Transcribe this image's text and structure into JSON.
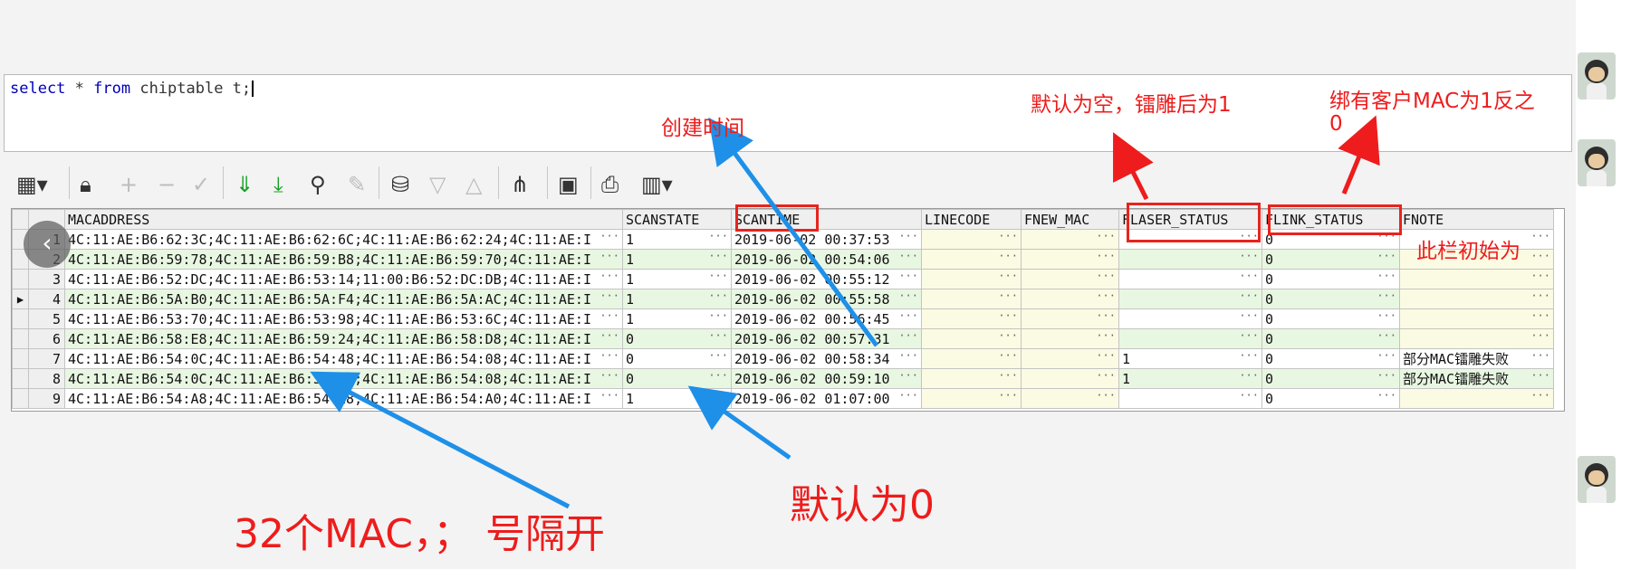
{
  "sql": {
    "keyword_select": "select",
    "star": " * ",
    "keyword_from": "from",
    "rest": " chiptable t;"
  },
  "grid": {
    "columns": [
      "MACADDRESS",
      "SCANSTATE",
      "SCANTIME",
      "LINECODE",
      "FNEW_MAC",
      "FLASER_STATUS",
      "FLINK_STATUS",
      "FNOTE"
    ],
    "rows": [
      {
        "n": "1",
        "mac": "4C:11:AE:B6:62:3C;4C:11:AE:B6:62:6C;4C:11:AE:B6:62:24;4C:11:AE:I",
        "scanstate": "1",
        "scantime": "2019-06-02 00:37:53",
        "linecode": "",
        "fnew_mac": "",
        "flaser": "",
        "flink": "0",
        "fnote": ""
      },
      {
        "n": "2",
        "mac": "4C:11:AE:B6:59:78;4C:11:AE:B6:59:B8;4C:11:AE:B6:59:70;4C:11:AE:I",
        "scanstate": "1",
        "scantime": "2019-06-02 00:54:06",
        "linecode": "",
        "fnew_mac": "",
        "flaser": "",
        "flink": "0",
        "fnote": ""
      },
      {
        "n": "3",
        "mac": "4C:11:AE:B6:52:DC;4C:11:AE:B6:53:14;11:00:B6:52:DC:DB;4C:11:AE:I",
        "scanstate": "1",
        "scantime": "2019-06-02 00:55:12",
        "linecode": "",
        "fnew_mac": "",
        "flaser": "",
        "flink": "0",
        "fnote": ""
      },
      {
        "n": "4",
        "mac": "4C:11:AE:B6:5A:B0;4C:11:AE:B6:5A:F4;4C:11:AE:B6:5A:AC;4C:11:AE:I",
        "scanstate": "1",
        "scantime": "2019-06-02 00:55:58",
        "linecode": "",
        "fnew_mac": "",
        "flaser": "",
        "flink": "0",
        "fnote": ""
      },
      {
        "n": "5",
        "mac": "4C:11:AE:B6:53:70;4C:11:AE:B6:53:98;4C:11:AE:B6:53:6C;4C:11:AE:I",
        "scanstate": "1",
        "scantime": "2019-06-02 00:56:45",
        "linecode": "",
        "fnew_mac": "",
        "flaser": "",
        "flink": "0",
        "fnote": ""
      },
      {
        "n": "6",
        "mac": "4C:11:AE:B6:58:E8;4C:11:AE:B6:59:24;4C:11:AE:B6:58:D8;4C:11:AE:I",
        "scanstate": "0",
        "scantime": "2019-06-02 00:57:31",
        "linecode": "",
        "fnew_mac": "",
        "flaser": "",
        "flink": "0",
        "fnote": ""
      },
      {
        "n": "7",
        "mac": "4C:11:AE:B6:54:0C;4C:11:AE:B6:54:48;4C:11:AE:B6:54:08;4C:11:AE:I",
        "scanstate": "0",
        "scantime": "2019-06-02 00:58:34",
        "linecode": "",
        "fnew_mac": "",
        "flaser": "1",
        "flink": "0",
        "fnote": "部分MAC镭雕失败"
      },
      {
        "n": "8",
        "mac": "4C:11:AE:B6:54:0C;4C:11:AE:B6:54:48;4C:11:AE:B6:54:08;4C:11:AE:I",
        "scanstate": "0",
        "scantime": "2019-06-02 00:59:10",
        "linecode": "",
        "fnew_mac": "",
        "flaser": "1",
        "flink": "0",
        "fnote": "部分MAC镭雕失败"
      },
      {
        "n": "9",
        "mac": "4C:11:AE:B6:54:A8;4C:11:AE:B6:54:E8;4C:11:AE:B6:54:A0;4C:11:AE:I",
        "scanstate": "1",
        "scantime": "2019-06-02 01:07:00",
        "linecode": "",
        "fnew_mac": "",
        "flaser": "",
        "flink": "0",
        "fnote": ""
      }
    ],
    "current_row": 4,
    "ellipsis": "···"
  },
  "annotations": {
    "created_time": "创建时间",
    "laser_default": "默认为空，镭雕后为1",
    "link_default_line1": "绑有客户MAC为1反之",
    "link_default_line2": "0",
    "fnote_initial": "此栏初始为",
    "default_zero": "默认为0",
    "mac_count": "32个MAC，；  号隔开"
  },
  "colors": {
    "annotation_red": "#ee1c1c",
    "arrow_blue": "#1e90e8",
    "row_green": "#e8f7e1",
    "yellow_cell": "#fbfbe3"
  },
  "icons": [
    "grid-view-icon",
    "lock-icon",
    "plus-icon",
    "minus-icon",
    "check-icon",
    "fetch-next-icon",
    "fetch-last-icon",
    "find-icon",
    "clear-icon",
    "query-icon",
    "filter-down-icon",
    "filter-up-icon",
    "tree-icon",
    "save-icon",
    "print-icon",
    "chart-icon"
  ]
}
